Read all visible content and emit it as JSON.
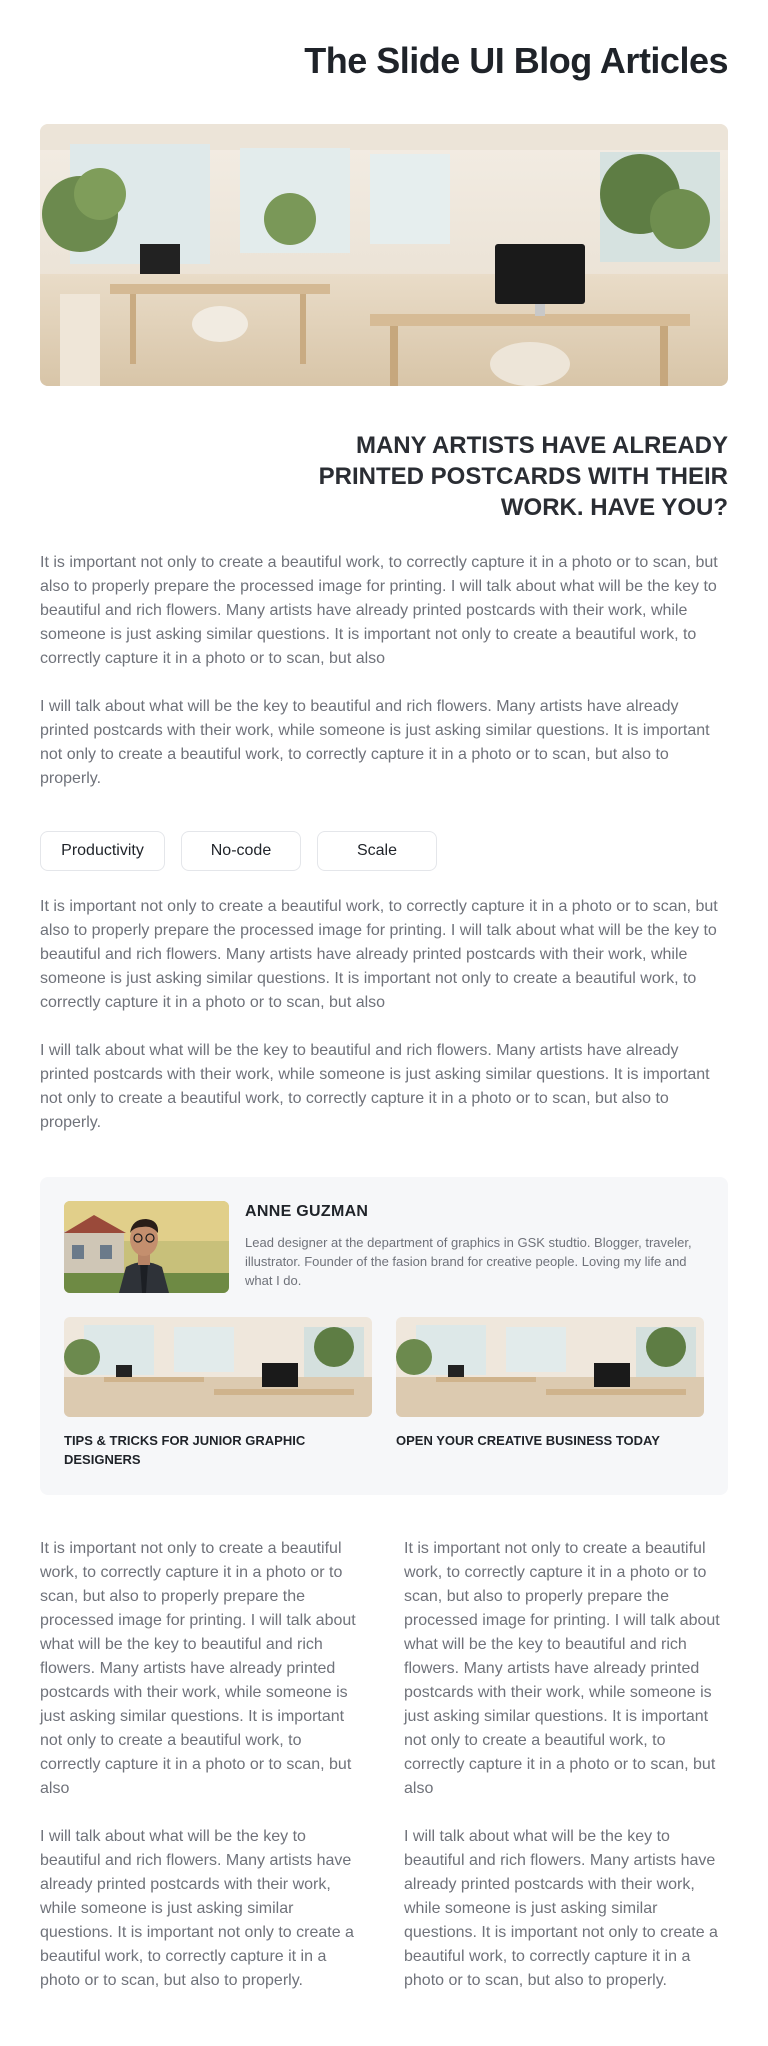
{
  "blog": {
    "title": "The Slide UI Blog Articles"
  },
  "article": {
    "heading": "MANY ARTISTS HAVE ALREADY PRINTED POSTCARDS WITH THEIR WORK. HAVE YOU?",
    "paragraph_1": "It is important not only to create a beautiful work, to correctly capture it in a photo or to scan, but also to properly prepare the processed image for printing. I will talk about what will be the key to beautiful and rich flowers. Many artists have already printed postcards with their work, while someone is just asking similar questions. It is important not only to create a beautiful work, to correctly capture it in a photo or to scan, but also",
    "paragraph_2": "I will talk about what will be the key to beautiful and rich flowers. Many artists have already printed postcards with their work, while someone is just asking similar questions. It is important not only to create a beautiful work, to correctly capture it in a photo or to scan, but also to properly.",
    "tags": [
      "Productivity",
      "No-code",
      "Scale"
    ]
  },
  "author": {
    "name": "ANNE GUZMAN",
    "bio": "Lead designer at the department of graphics in GSK studtio. Blogger, traveler, illustrator. Founder of the fasion brand for creative people. Loving my life and what I do."
  },
  "related": [
    {
      "title": "TIPS & TRICKS FOR JUNIOR GRAPHIC DESIGNERS"
    },
    {
      "title": "OPEN YOUR CREATIVE BUSINESS TODAY"
    }
  ],
  "colors": {
    "heading": "#1f2329",
    "body_text": "#6f727a",
    "card_bg": "#f6f7f9",
    "tag_border": "#e4e6ea"
  },
  "icons": {
    "hero": "office-photo",
    "avatar": "author-photo"
  }
}
